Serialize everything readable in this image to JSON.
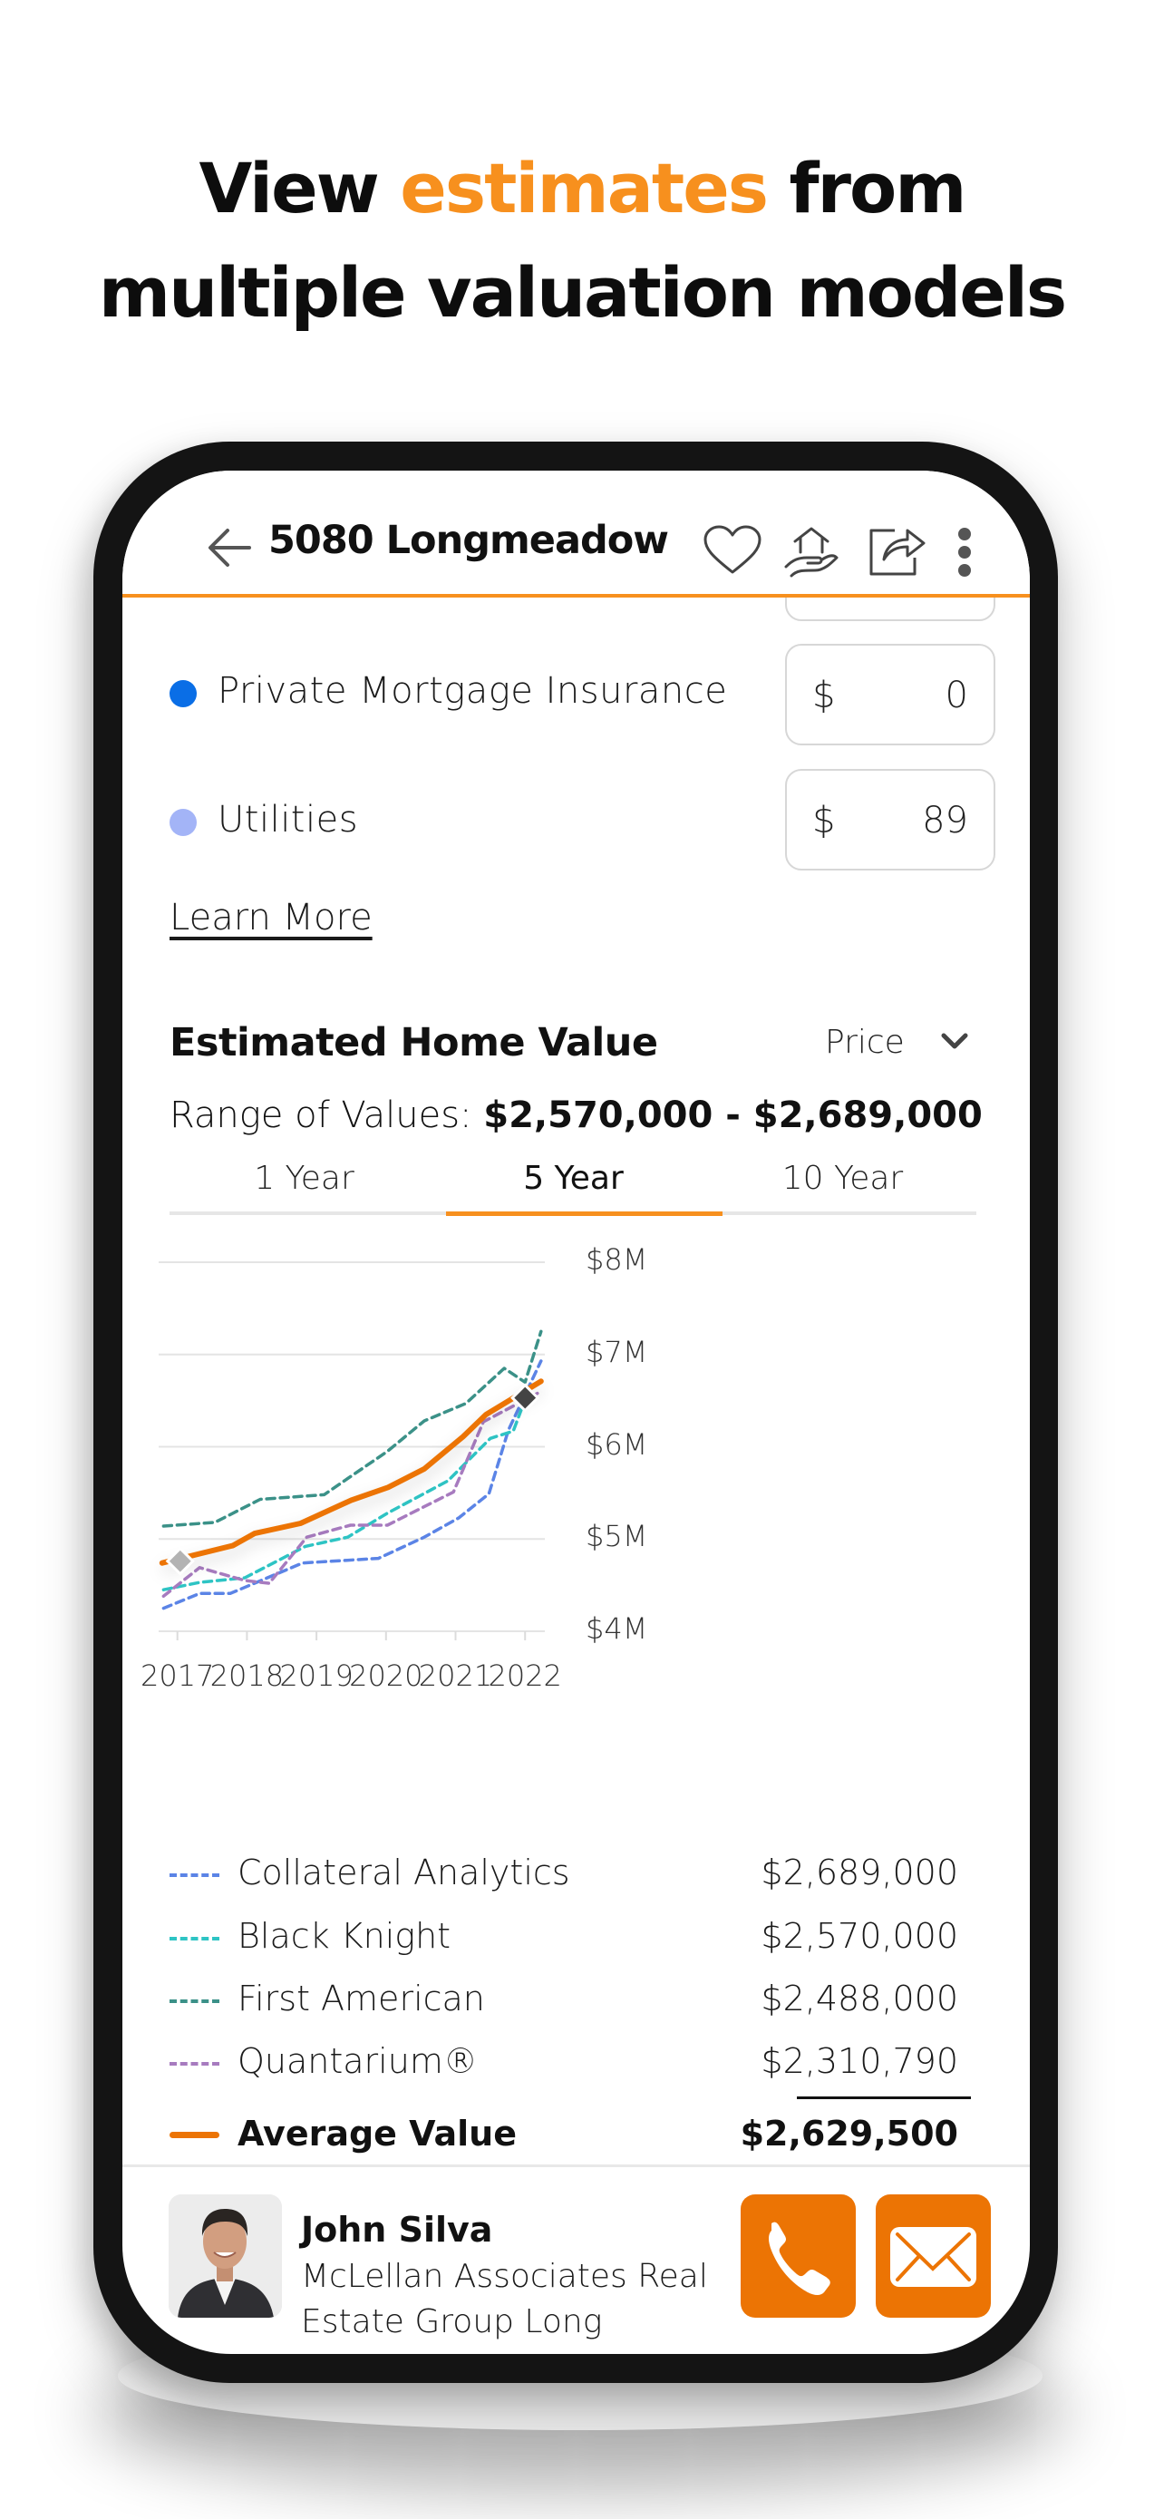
{
  "headline": {
    "line1_prefix": "View ",
    "line1_accent": "estimates",
    "line1_suffix": " from",
    "line2": "multiple valuation models",
    "accent_color": "#f7901e"
  },
  "header": {
    "back_icon": "arrow-left-icon",
    "title": "5080 Longmeadow",
    "icons": [
      "heart-icon",
      "house-in-hand-icon",
      "share-icon",
      "more-vertical-icon"
    ]
  },
  "expenses": {
    "rows": [
      {
        "label": "Private Mortgage Insurance",
        "currency": "$",
        "value": "0",
        "dot_color": "#0a6ee6"
      },
      {
        "label": "Utilities",
        "currency": "$",
        "value": "89",
        "dot_color": "#a3b4f7"
      }
    ],
    "learn_more": "Learn More"
  },
  "home_value": {
    "title": "Estimated Home Value",
    "dropdown": {
      "selected": "Price",
      "icon": "chevron-down-icon"
    },
    "range_label": "Range of Values:",
    "range_value": "$2,570,000 - $2,689,000",
    "tabs": [
      {
        "label": "1 Year",
        "active": false
      },
      {
        "label": "5 Year",
        "active": true
      },
      {
        "label": "10 Year",
        "active": false
      }
    ]
  },
  "chart_data": {
    "type": "line",
    "title": "",
    "xlabel": "",
    "ylabel": "",
    "x_ticks": [
      "2017",
      "2018",
      "2019",
      "2020",
      "2021",
      "2022"
    ],
    "y_ticks": [
      "$8M",
      "$7M",
      "$6M",
      "$5M",
      "$4M"
    ],
    "y_tick_values": [
      8,
      7,
      6,
      5,
      4
    ],
    "xlim": [
      2016.8,
      2022.25
    ],
    "ylim": [
      4,
      8
    ],
    "y_units": "$M",
    "grid": "horizontal",
    "series": [
      {
        "name": "Collateral Analytics",
        "color": "#5b84e6",
        "style": "dashed",
        "x": [
          2016.8,
          2017.32,
          2017.76,
          2018.8,
          2019.89,
          2020.55,
          2021.05,
          2021.48,
          2021.76,
          2022.23
        ],
        "y": [
          4.25,
          4.41,
          4.41,
          4.74,
          4.79,
          5.02,
          5.23,
          5.49,
          6.18,
          6.93
        ]
      },
      {
        "name": "Black Knight",
        "color": "#2ec4c4",
        "style": "dashed",
        "x": [
          2016.8,
          2017.32,
          2017.97,
          2018.84,
          2019.45,
          2020.02,
          2020.89,
          2021.5,
          2021.83,
          2022.02
        ],
        "y": [
          4.45,
          4.53,
          4.58,
          4.92,
          5.02,
          5.28,
          5.63,
          6.09,
          6.17,
          6.55
        ]
      },
      {
        "name": "First American",
        "color": "#3b9188",
        "style": "dashed",
        "x": [
          2016.8,
          2017.54,
          2018.19,
          2019.11,
          2020.02,
          2020.55,
          2021.15,
          2021.7,
          2022.0,
          2022.23
        ],
        "y": [
          5.14,
          5.18,
          5.43,
          5.48,
          5.95,
          6.28,
          6.47,
          6.85,
          6.7,
          7.25
        ]
      },
      {
        "name": "Quantarium",
        "color": "#a77bbf",
        "style": "dashed",
        "x": [
          2016.8,
          2017.32,
          2017.97,
          2018.32,
          2018.86,
          2019.49,
          2020.02,
          2020.97,
          2021.4,
          2022.23
        ],
        "y": [
          4.38,
          4.69,
          4.55,
          4.52,
          5.02,
          5.15,
          5.15,
          5.51,
          6.27,
          6.6
        ]
      },
      {
        "name": "Average Value",
        "color": "#ec7404",
        "style": "solid",
        "x": [
          2016.78,
          2017.8,
          2018.11,
          2018.77,
          2019.5,
          2020.03,
          2020.55,
          2021.11,
          2021.44,
          2022.23
        ],
        "y": [
          4.74,
          4.93,
          5.06,
          5.17,
          5.42,
          5.56,
          5.76,
          6.11,
          6.35,
          6.71
        ]
      }
    ],
    "markers": [
      {
        "name": "start-marker",
        "x": 2017.04,
        "y": 4.76,
        "color": "#b3b3b3",
        "shape": "diamond"
      },
      {
        "name": "current-marker",
        "x": 2022.0,
        "y": 6.53,
        "color": "#444444",
        "shape": "diamond"
      }
    ],
    "legend": [
      {
        "name": "Collateral Analytics",
        "value": "$2,689,000"
      },
      {
        "name": "Black Knight",
        "value": "$2,570,000"
      },
      {
        "name": "First American",
        "value": "$2,488,000"
      },
      {
        "name": "Quantarium®",
        "value": "$2,310,790"
      },
      {
        "name": "Average Value",
        "value": "$2,629,500"
      }
    ],
    "legend_placement": "bottom"
  },
  "agent": {
    "name": "John Silva",
    "company": "McLellan Associates Real Estate Group Long Name..",
    "call_icon": "phone-icon",
    "email_icon": "mail-icon",
    "button_color": "#ec7404"
  }
}
